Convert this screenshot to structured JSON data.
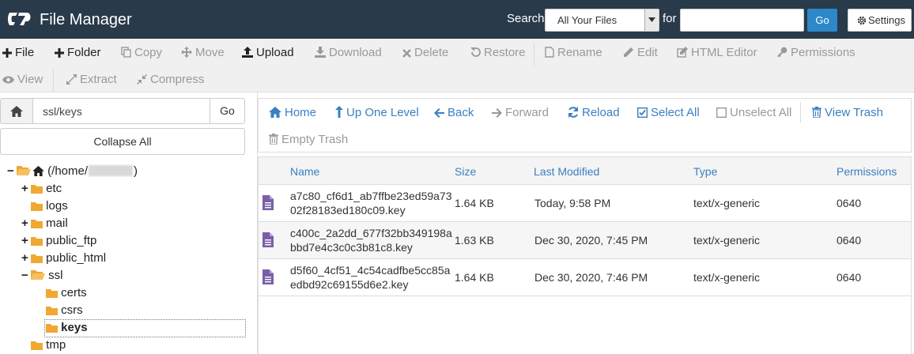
{
  "header": {
    "title": "File Manager",
    "search_label": "Search",
    "search_scope": "All Your Files",
    "for_label": "for",
    "search_value": "",
    "go": "Go",
    "settings": "Settings",
    "bg_color": "#293a4a"
  },
  "toolbar": {
    "file": "File",
    "folder": "Folder",
    "copy": "Copy",
    "move": "Move",
    "upload": "Upload",
    "download": "Download",
    "delete": "Delete",
    "restore": "Restore",
    "rename": "Rename",
    "edit": "Edit",
    "html_editor": "HTML Editor",
    "permissions": "Permissions",
    "view": "View",
    "extract": "Extract",
    "compress": "Compress"
  },
  "left": {
    "path": "ssl/keys",
    "go": "Go",
    "collapse_all": "Collapse All",
    "tree": {
      "root_prefix": "(/home/",
      "root_suffix": ")",
      "etc": "etc",
      "logs": "logs",
      "mail": "mail",
      "public_ftp": "public_ftp",
      "public_html": "public_html",
      "ssl": "ssl",
      "certs": "certs",
      "csrs": "csrs",
      "keys": "keys",
      "tmp": "tmp"
    }
  },
  "nav": {
    "home": "Home",
    "up": "Up One Level",
    "back": "Back",
    "forward": "Forward",
    "reload": "Reload",
    "select_all": "Select All",
    "unselect_all": "Unselect All",
    "view_trash": "View Trash",
    "empty_trash": "Empty Trash"
  },
  "table": {
    "headers": {
      "name": "Name",
      "size": "Size",
      "modified": "Last Modified",
      "type": "Type",
      "perms": "Permissions"
    },
    "rows": [
      {
        "name": "a7c80_cf6d1_ab7ffbe23ed59a7302f28183ed180c09.key",
        "size": "1.64 KB",
        "modified": "Today, 9:58 PM",
        "type": "text/x-generic",
        "perms": "0640"
      },
      {
        "name": "c400c_2a2dd_677f32bb349198abbd7e4c3c0c3b81c8.key",
        "size": "1.63 KB",
        "modified": "Dec 30, 2020, 7:45 PM",
        "type": "text/x-generic",
        "perms": "0640"
      },
      {
        "name": "d5f60_4cf51_4c54cadfbe5cc85aedbd92c69155d6e2.key",
        "size": "1.64 KB",
        "modified": "Dec 30, 2020, 7:46 PM",
        "type": "text/x-generic",
        "perms": "0640"
      }
    ]
  },
  "colors": {
    "accent": "#2d87c9",
    "link": "#3a7fc0",
    "folder": "#f0a830",
    "file_icon": "#7b5ea7"
  }
}
